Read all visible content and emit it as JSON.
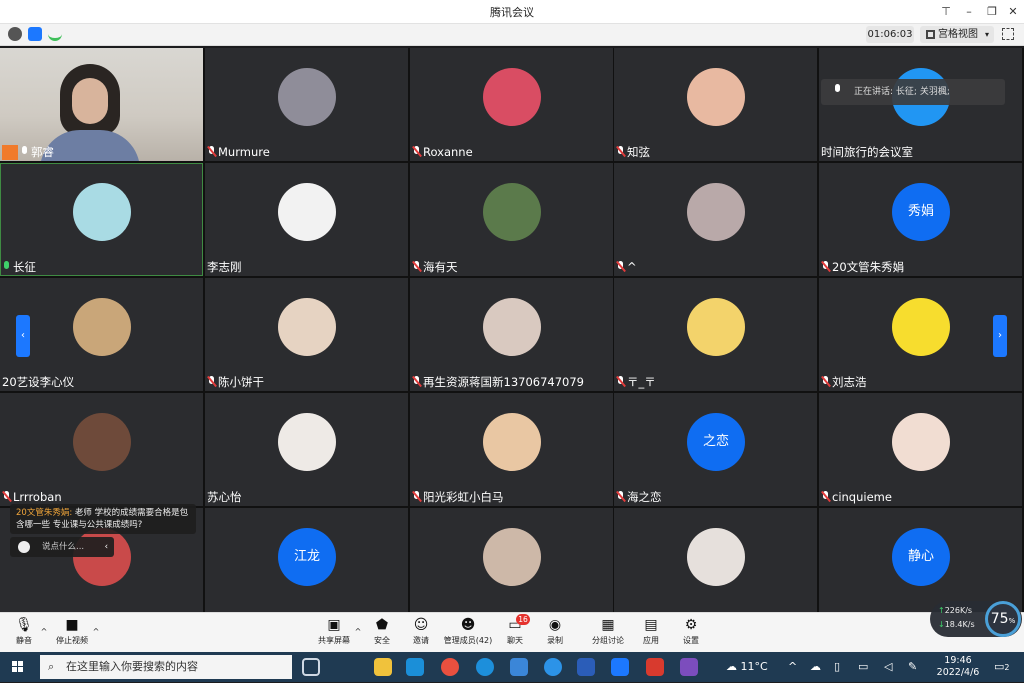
{
  "window": {
    "title": "腾讯会议"
  },
  "infobar": {
    "timer": "01:06:03",
    "view_label": "宫格视图"
  },
  "speaking": {
    "prefix": "正在讲话:",
    "names": "长征; 关羽楓;"
  },
  "tiles": [
    {
      "name": "郭睿",
      "mic": "on",
      "kind": "video"
    },
    {
      "name": "Murmure",
      "mic": "muted",
      "kind": "photo",
      "color": "#8f8d99"
    },
    {
      "name": "Roxanne",
      "mic": "muted",
      "kind": "photo",
      "color": "#d94d63"
    },
    {
      "name": "知弦",
      "mic": "muted",
      "kind": "photo",
      "color": "#e8b9a1"
    },
    {
      "name": "时间旅行的会议室",
      "mic": "none",
      "kind": "photo",
      "color": "#2196f3"
    },
    {
      "name": "长征",
      "mic": "speaking",
      "kind": "photo",
      "color": "#a9dbe4"
    },
    {
      "name": "李志刚",
      "mic": "none",
      "kind": "photo",
      "color": "#f2f2f2"
    },
    {
      "name": "海有天",
      "mic": "muted",
      "kind": "photo",
      "color": "#5b7a4b"
    },
    {
      "name": "^",
      "mic": "muted",
      "kind": "photo",
      "color": "#b9a9a9"
    },
    {
      "name": "20文管朱秀娟",
      "mic": "muted",
      "kind": "initials",
      "initials": "秀娟"
    },
    {
      "name": "20艺设李心仪",
      "mic": "none",
      "kind": "photo",
      "color": "#c9a679"
    },
    {
      "name": "陈小饼干",
      "mic": "muted",
      "kind": "photo",
      "color": "#e6d3c2"
    },
    {
      "name": "再生资源蒋国新13706747079",
      "mic": "muted",
      "kind": "photo",
      "color": "#d9c9c0"
    },
    {
      "name": "〒_〒",
      "mic": "muted",
      "kind": "photo",
      "color": "#f3d36b"
    },
    {
      "name": "刘志浩",
      "mic": "muted",
      "kind": "photo",
      "color": "#f7dd2e"
    },
    {
      "name": "Lrrroban",
      "mic": "muted",
      "kind": "photo",
      "color": "#6e4a3a"
    },
    {
      "name": "苏心怡",
      "mic": "none",
      "kind": "photo",
      "color": "#eeeae6"
    },
    {
      "name": "阳光彩虹小白马",
      "mic": "muted",
      "kind": "photo",
      "color": "#e9c7a3"
    },
    {
      "name": "海之恋",
      "mic": "muted",
      "kind": "initials",
      "initials": "之恋"
    },
    {
      "name": "cinquieme",
      "mic": "muted",
      "kind": "photo",
      "color": "#f1ddd2"
    },
    {
      "name": "",
      "mic": "none",
      "kind": "photo",
      "color": "#c94a4a"
    },
    {
      "name": "",
      "mic": "none",
      "kind": "initials",
      "initials": "江龙"
    },
    {
      "name": "",
      "mic": "none",
      "kind": "photo",
      "color": "#cdb8a8"
    },
    {
      "name": "",
      "mic": "none",
      "kind": "photo",
      "color": "#e6e0dc"
    },
    {
      "name": "",
      "mic": "none",
      "kind": "initials",
      "initials": "静心"
    }
  ],
  "chat": {
    "sender": "20文管朱秀娟:",
    "message": "老师 学校的成绩需要合格是包含哪一些 专业课与公共课成绩吗?",
    "input_placeholder": "说点什么..."
  },
  "toolbar": {
    "mute": "静音",
    "video": "停止视频",
    "share": "共享屏幕",
    "security": "安全",
    "invite": "邀请",
    "members": "管理成员(42)",
    "chat": "聊天",
    "chat_badge": "16",
    "record": "录制",
    "breakout": "分组讨论",
    "apps": "应用",
    "settings": "设置"
  },
  "network": {
    "up": "226",
    "down": "18.4",
    "unit": "K/s",
    "quality": "75"
  },
  "taskbar": {
    "search_placeholder": "在这里输入你要搜索的内容",
    "weather": "11°C",
    "time": "19:46",
    "date": "2022/4/6",
    "notifications": "2"
  }
}
